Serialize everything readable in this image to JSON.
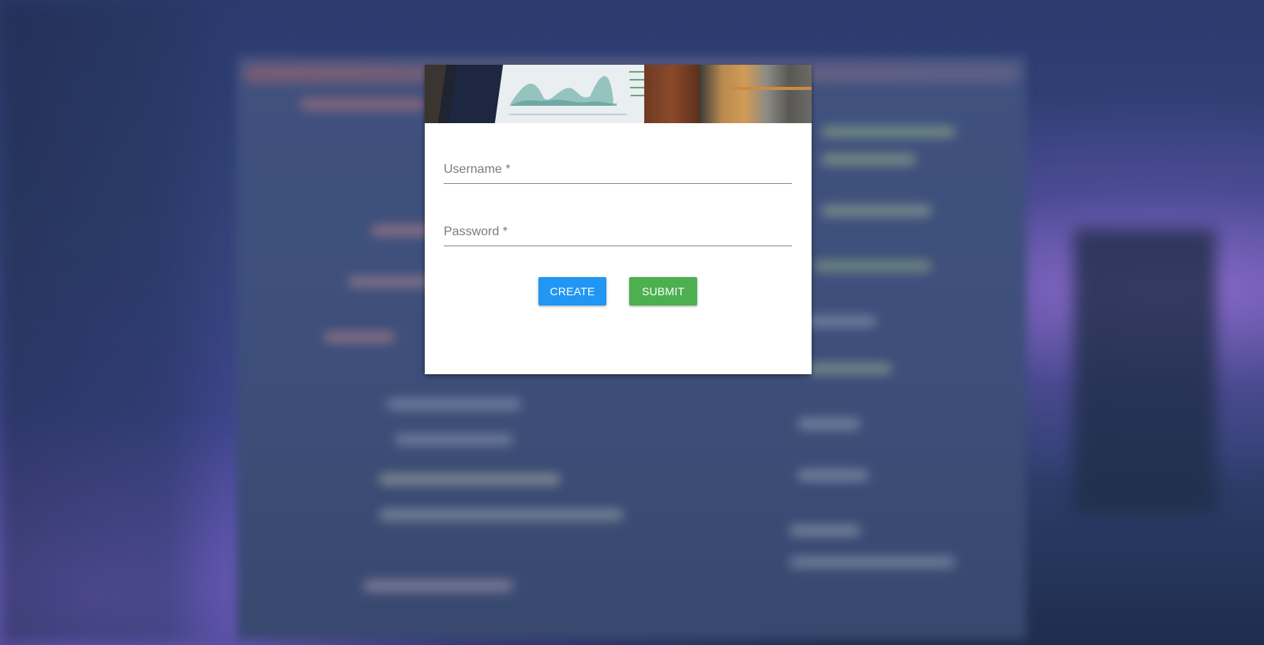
{
  "colors": {
    "create_button": "#2196f3",
    "submit_button": "#4caf50",
    "card_background": "#ffffff",
    "field_label": "#7c7c7c"
  },
  "login_form": {
    "username": {
      "label": "Username *",
      "value": ""
    },
    "password": {
      "label": "Password *",
      "value": ""
    },
    "create_label": "CREATE",
    "submit_label": "SUBMIT"
  },
  "icons": {
    "banner_image": "dashboard-laptop-photo"
  }
}
